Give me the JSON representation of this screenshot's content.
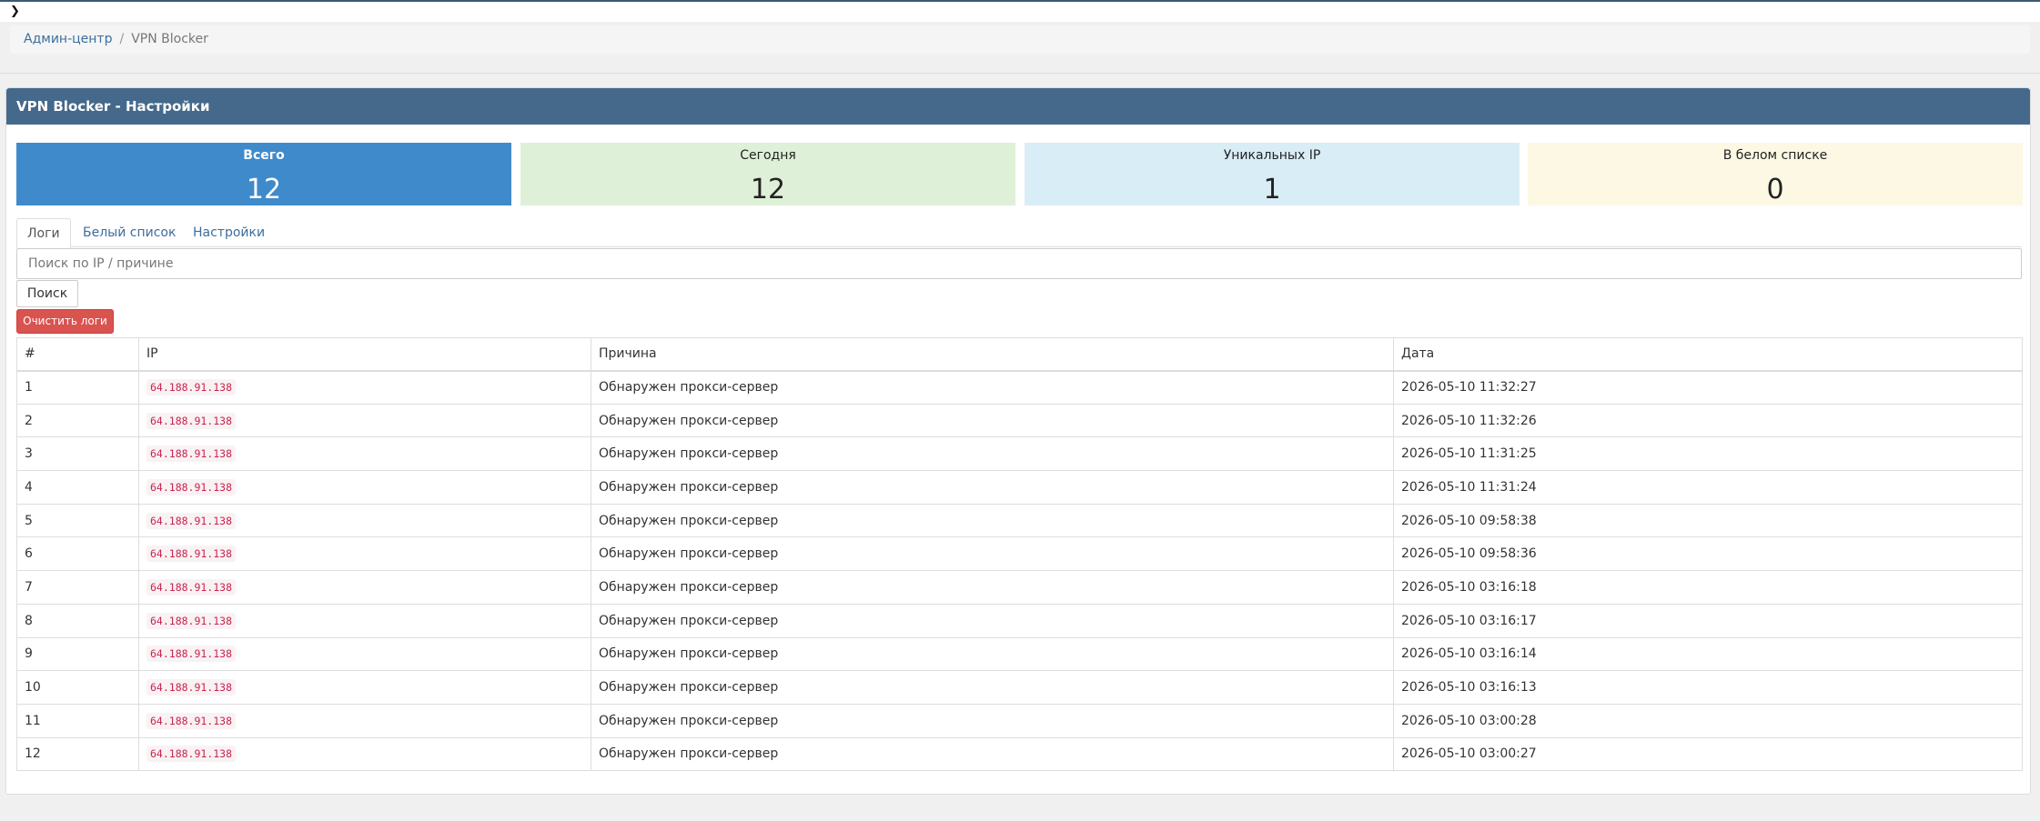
{
  "breadcrumb": {
    "home": "Админ-центр",
    "separator": "/",
    "current": "VPN Blocker"
  },
  "panel": {
    "title": "VPN Blocker - Настройки"
  },
  "stats": {
    "total": {
      "label": "Всего",
      "value": "12"
    },
    "today": {
      "label": "Сегодня",
      "value": "12"
    },
    "unique": {
      "label": "Уникальных IP",
      "value": "1"
    },
    "whitelist": {
      "label": "В белом списке",
      "value": "0"
    }
  },
  "tabs": {
    "logs": "Логи",
    "whitelist": "Белый список",
    "settings": "Настройки"
  },
  "search": {
    "placeholder": "Поиск по IP / причине",
    "value": "",
    "button": "Поиск"
  },
  "actions": {
    "clear_logs": "Очистить логи"
  },
  "table": {
    "headers": [
      "#",
      "IP",
      "Причина",
      "Дата"
    ],
    "rows": [
      {
        "num": "1",
        "ip": "64.188.91.138",
        "reason": "Обнаружен прокси-сервер",
        "date": "2026-05-10 11:32:27"
      },
      {
        "num": "2",
        "ip": "64.188.91.138",
        "reason": "Обнаружен прокси-сервер",
        "date": "2026-05-10 11:32:26"
      },
      {
        "num": "3",
        "ip": "64.188.91.138",
        "reason": "Обнаружен прокси-сервер",
        "date": "2026-05-10 11:31:25"
      },
      {
        "num": "4",
        "ip": "64.188.91.138",
        "reason": "Обнаружен прокси-сервер",
        "date": "2026-05-10 11:31:24"
      },
      {
        "num": "5",
        "ip": "64.188.91.138",
        "reason": "Обнаружен прокси-сервер",
        "date": "2026-05-10 09:58:38"
      },
      {
        "num": "6",
        "ip": "64.188.91.138",
        "reason": "Обнаружен прокси-сервер",
        "date": "2026-05-10 09:58:36"
      },
      {
        "num": "7",
        "ip": "64.188.91.138",
        "reason": "Обнаружен прокси-сервер",
        "date": "2026-05-10 03:16:18"
      },
      {
        "num": "8",
        "ip": "64.188.91.138",
        "reason": "Обнаружен прокси-сервер",
        "date": "2026-05-10 03:16:17"
      },
      {
        "num": "9",
        "ip": "64.188.91.138",
        "reason": "Обнаружен прокси-сервер",
        "date": "2026-05-10 03:16:14"
      },
      {
        "num": "10",
        "ip": "64.188.91.138",
        "reason": "Обнаружен прокси-сервер",
        "date": "2026-05-10 03:16:13"
      },
      {
        "num": "11",
        "ip": "64.188.91.138",
        "reason": "Обнаружен прокси-сервер",
        "date": "2026-05-10 03:00:28"
      },
      {
        "num": "12",
        "ip": "64.188.91.138",
        "reason": "Обнаружен прокси-сервер",
        "date": "2026-05-10 03:00:27"
      }
    ]
  },
  "icons": {
    "sidebar_toggle": "chevron-right-icon"
  },
  "colors": {
    "header_bar": "#45698b",
    "stat_total": "#3f8acb",
    "stat_today": "#dff0d8",
    "stat_unique": "#d9edf7",
    "stat_whitelist": "#fcf8e3",
    "danger": "#d9534f",
    "ip_code": "#c7254e"
  }
}
